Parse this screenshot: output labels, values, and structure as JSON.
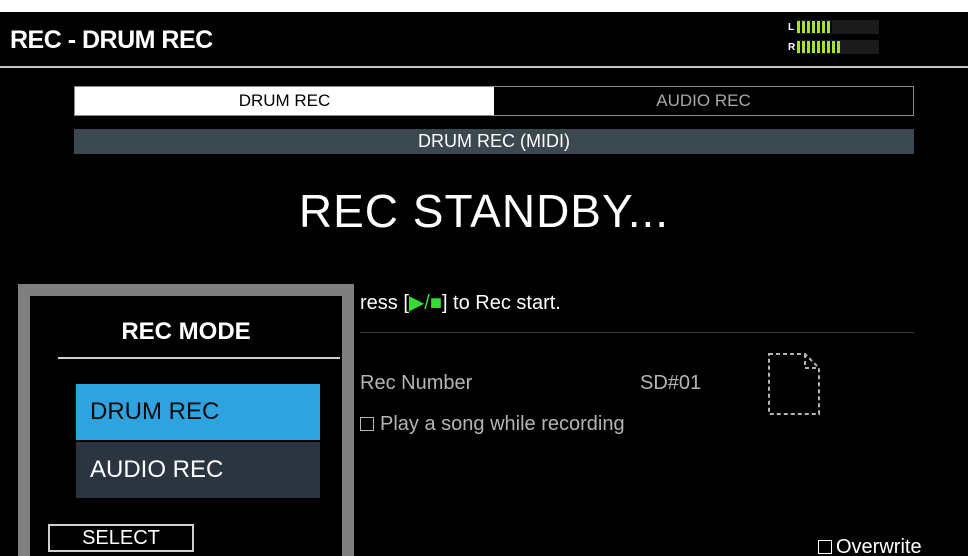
{
  "header": {
    "title": "REC - DRUM REC"
  },
  "level_meter": {
    "left_label": "L",
    "right_label": "R",
    "left_level": 0.43,
    "right_level": 0.52
  },
  "tabs": [
    {
      "label": "DRUM REC",
      "active": true
    },
    {
      "label": "AUDIO REC",
      "active": false
    }
  ],
  "mode_bar": {
    "label": "DRUM REC (MIDI)"
  },
  "status": {
    "text": "REC STANDBY..."
  },
  "instruction": {
    "prefix": "ress [",
    "play_glyph": "▶/■",
    "suffix": "] to Rec start."
  },
  "rec_number": {
    "label": "Rec Number",
    "value": "SD#01"
  },
  "play_song": {
    "label": "Play a song while recording",
    "checked": false
  },
  "overwrite": {
    "label": "Overwrite",
    "checked": false
  },
  "popup": {
    "title": "REC MODE",
    "options": [
      {
        "label": "DRUM REC",
        "selected": true
      },
      {
        "label": "AUDIO REC",
        "selected": false
      }
    ],
    "select_label": "SELECT"
  },
  "colors": {
    "selected": "#2fa3e0",
    "meter": "#a6e22e",
    "play_icon": "#33dd33"
  }
}
